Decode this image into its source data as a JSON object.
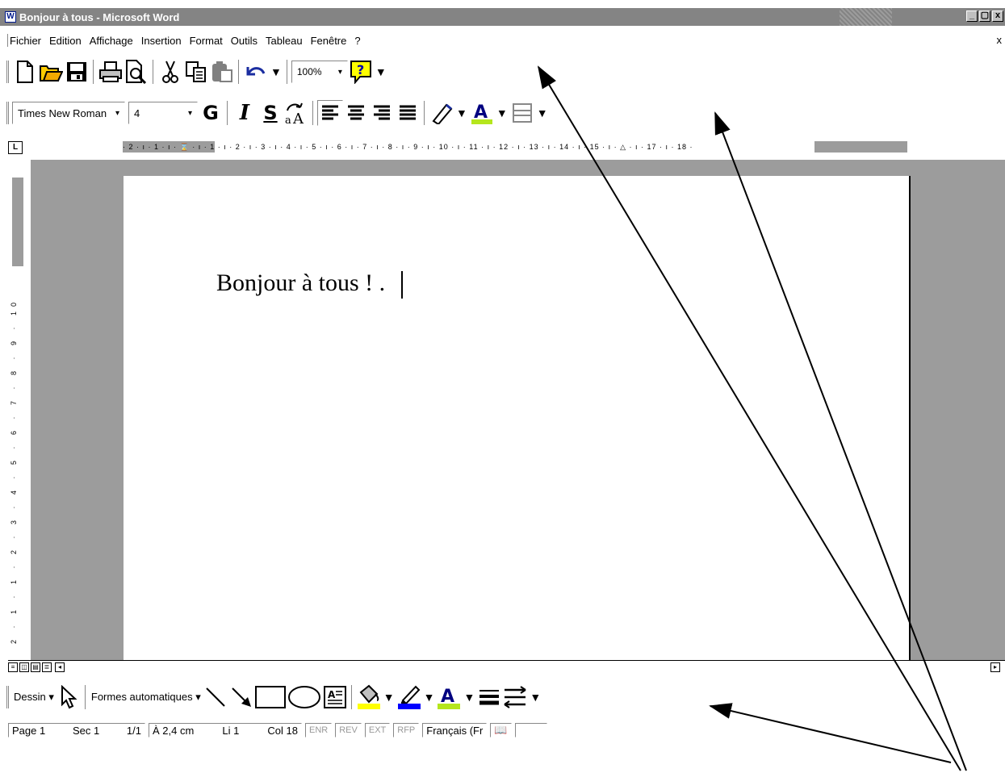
{
  "window": {
    "title": "Bonjour à tous - Microsoft Word",
    "minimize": "_",
    "restore": "🗗",
    "close": "x",
    "app_icon": "W"
  },
  "menu": {
    "items": [
      "Fichier",
      "Edition",
      "Affichage",
      "Insertion",
      "Format",
      "Outils",
      "Tableau",
      "Fenêtre",
      "?"
    ],
    "doc_close": "x"
  },
  "standard_toolbar": {
    "zoom": "100%",
    "buttons": [
      "new-icon",
      "open-icon",
      "save-icon",
      "print-icon",
      "print-preview-icon",
      "cut-icon",
      "copy-icon",
      "paste-icon",
      "undo-icon",
      "help-icon"
    ]
  },
  "format_toolbar": {
    "font": "Times New Roman",
    "size": "4",
    "bold": "G",
    "italic": "I",
    "underline": "S",
    "buttons": [
      "bold-icon",
      "italic-icon",
      "underline-icon",
      "shrink-font-icon",
      "align-left-icon",
      "align-center-icon",
      "align-right-icon",
      "justify-icon",
      "highlight-icon",
      "font-color-icon",
      "border-icon"
    ],
    "highlight_color": "#b5e61d",
    "font_color_underline": "#b5e61d"
  },
  "ruler": {
    "horizontal": "· 2 · ı · 1 · ı · ⌛ · ı · 1 · ı · 2 · ı · 3 · ı · 4 · ı · 5 · ı · 6 · ı · 7 · ı · 8 · ı · 9 · ı · 10 · ı · 11 · ı · 12 · ı · 13 · ı · 14 · ı · 15 · ı · △ · ı · 17 · ı · 18 ·",
    "vertical": "2 · 1 · 1 · 2 · 3 · 4 · 5 · 6 · 7 · 8 · 9 · 10",
    "corner": "L"
  },
  "document": {
    "text": "Bonjour à tous ! ."
  },
  "drawing_toolbar": {
    "draw_label": "Dessin",
    "autoshapes_label": "Formes automatiques",
    "buttons": [
      "select-objects-icon",
      "line-icon",
      "arrow-icon",
      "rectangle-icon",
      "oval-icon",
      "text-box-icon",
      "fill-color-icon",
      "line-color-icon",
      "font-color-icon",
      "line-style-icon",
      "arrow-style-icon"
    ],
    "fill_color": "#ffff00",
    "line_color": "#0000ff",
    "text_color": "#b5e61d"
  },
  "status": {
    "page": "Page  1",
    "sec": "Sec  1",
    "pages": "1/1",
    "at": "À 2,4 cm",
    "line": "Li  1",
    "col": "Col  18",
    "enr": "ENR",
    "rev": "REV",
    "ext": "EXT",
    "rfp": "RFP",
    "lang": "Français (Fr",
    "spell_icon": "book-icon"
  }
}
